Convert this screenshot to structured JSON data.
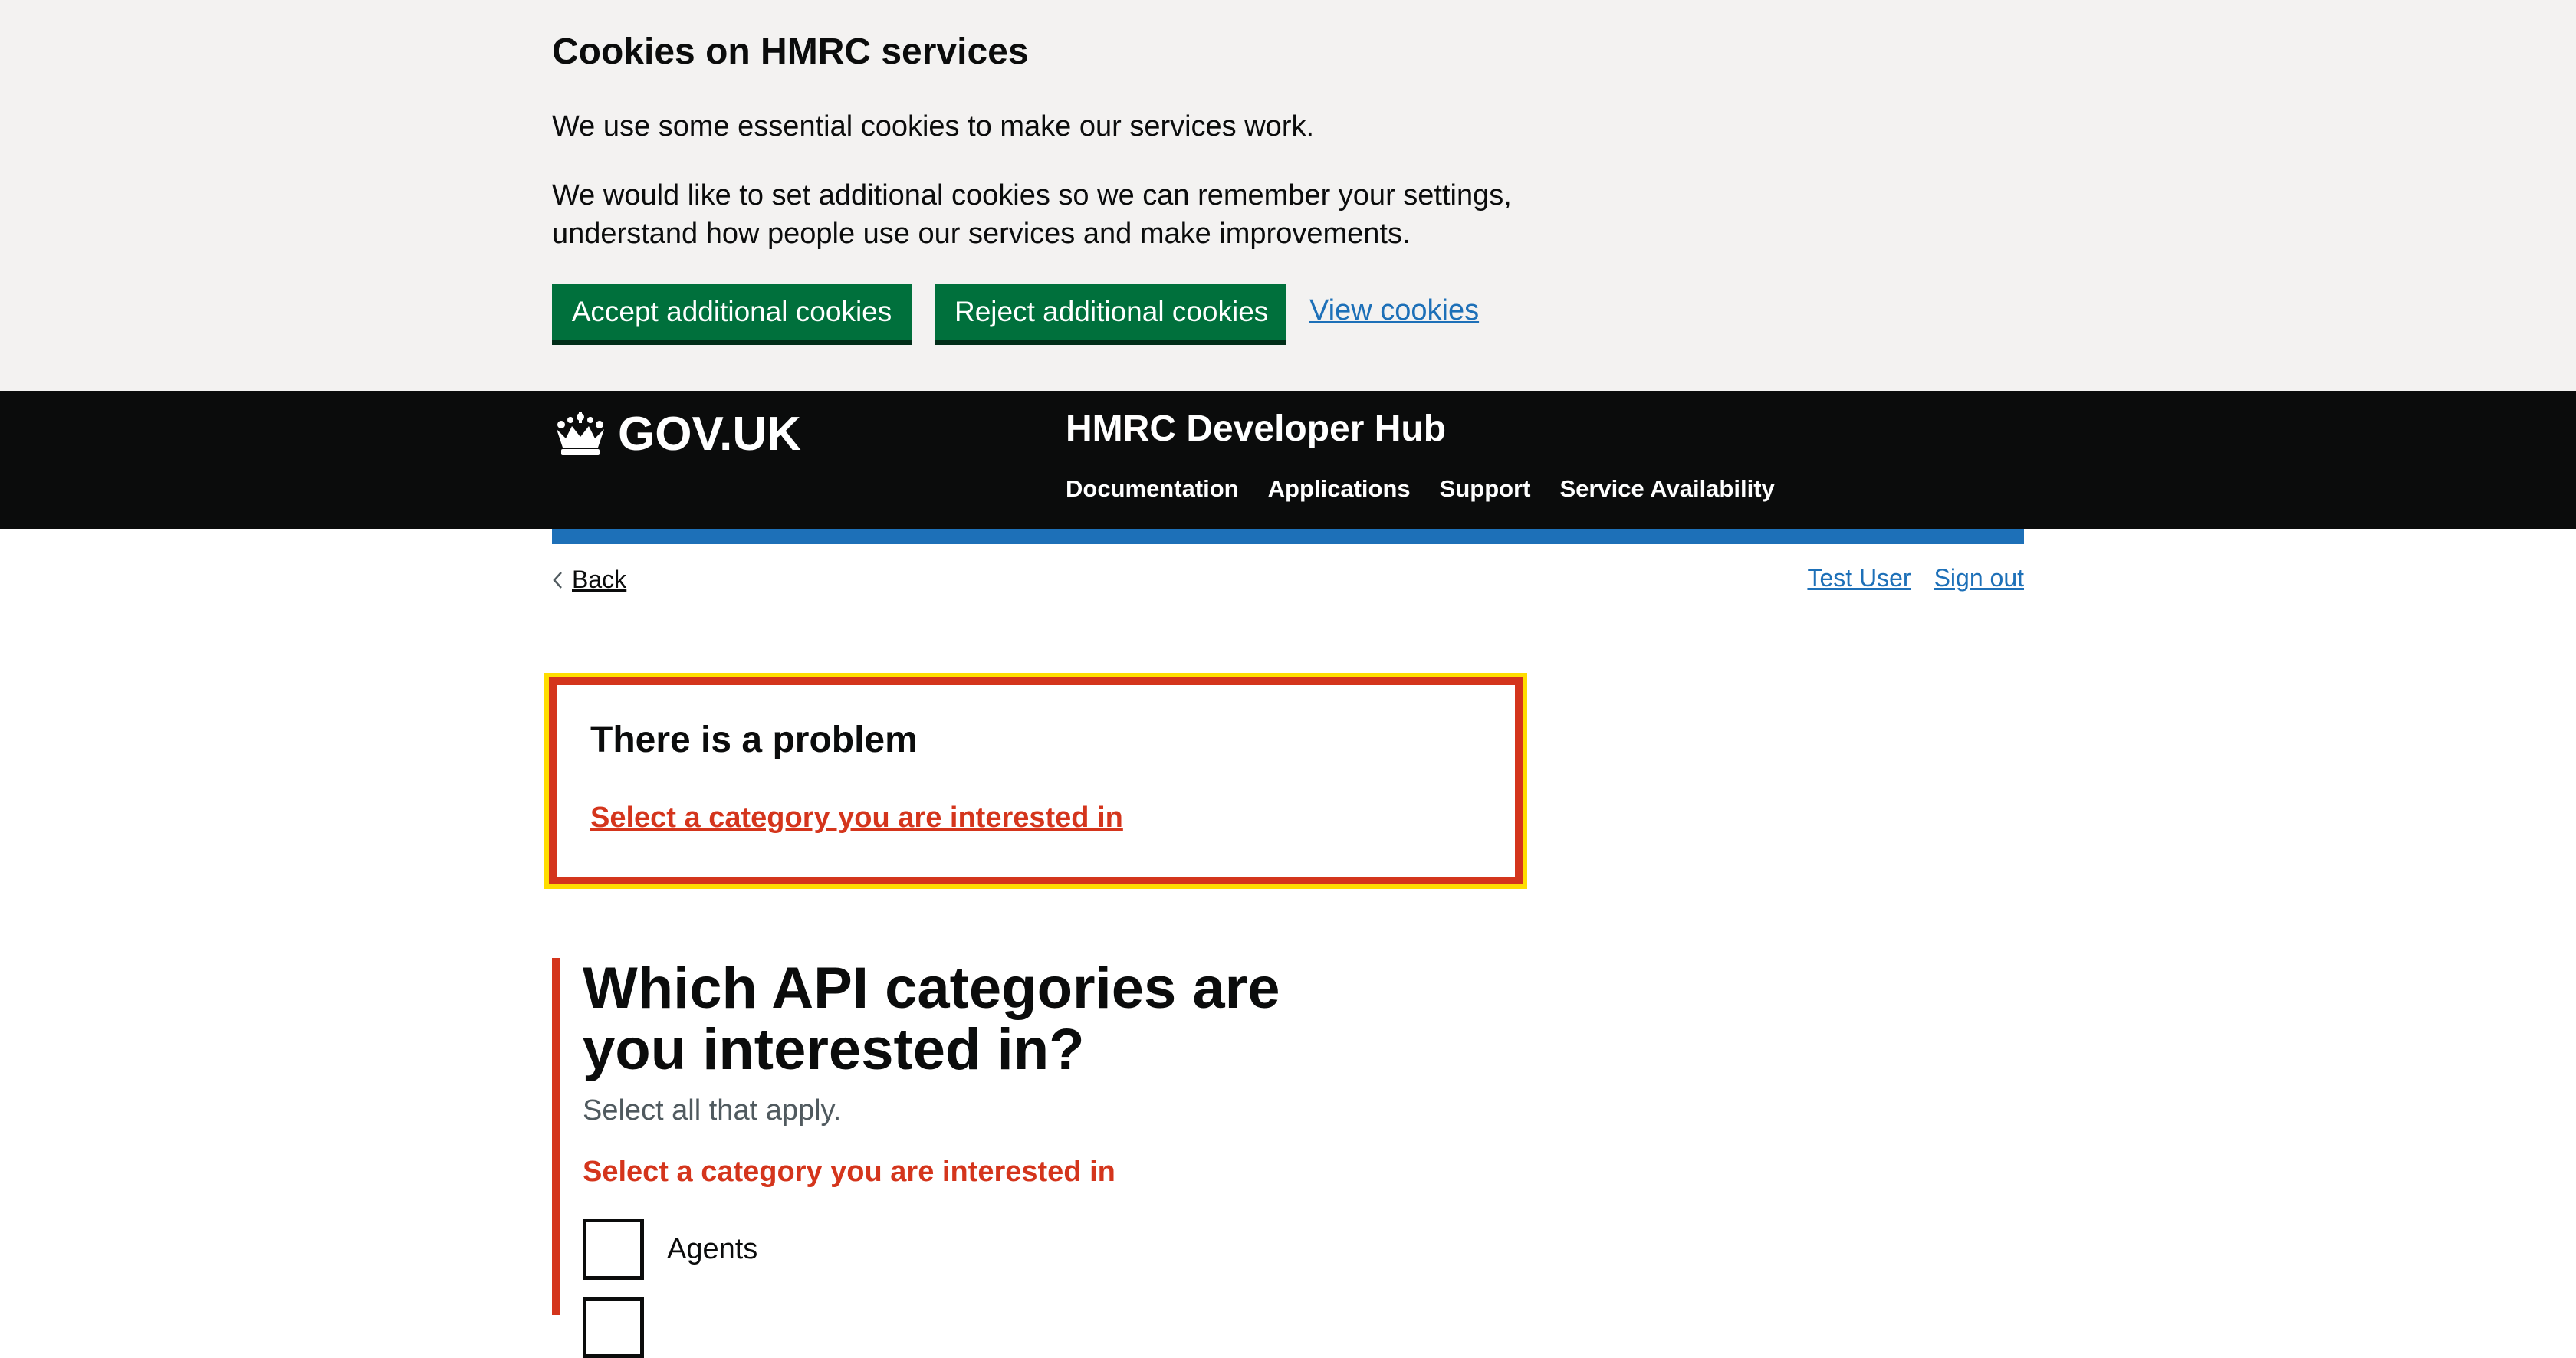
{
  "cookie_banner": {
    "title": "Cookies on HMRC services",
    "paragraph_1": "We use some essential cookies to make our services work.",
    "paragraph_2": "We would like to set additional cookies so we can remember your settings, understand how people use our services and make improvements.",
    "accept_label": "Accept additional cookies",
    "reject_label": "Reject additional cookies",
    "view_label": "View cookies",
    "button_color": "#00703c"
  },
  "header": {
    "logo_icon": "crown-icon",
    "logo_text": "GOV.UK",
    "service_name": "HMRC Developer Hub",
    "nav": [
      "Documentation",
      "Applications",
      "Support",
      "Service Availability"
    ],
    "accent_color": "#1d70b8"
  },
  "page": {
    "back_label": "Back",
    "user_name": "Test User",
    "sign_out_label": "Sign out"
  },
  "error_summary": {
    "title": "There is a problem",
    "link": "Select a category you are interested in",
    "error_color": "#d4351c",
    "focus_color": "#ffdd00"
  },
  "form": {
    "question": "Which API categories are you interested in?",
    "hint": "Select all that apply.",
    "error_message": "Select a category you are interested in",
    "options": [
      "Agents",
      ""
    ]
  }
}
